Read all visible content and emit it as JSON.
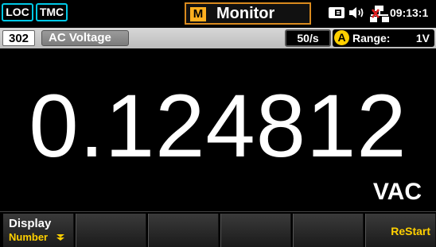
{
  "status_bar": {
    "loc_badge": "LOC",
    "tmc_badge": "TMC",
    "mode_letter": "M",
    "mode_title": "Monitor",
    "time": "09:13:1",
    "icons": [
      "storage-icon",
      "speaker-icon",
      "network-disconnected-icon"
    ]
  },
  "info_bar": {
    "channel": "302",
    "function": "AC Voltage",
    "rate": "50/s",
    "auto_indicator": "A",
    "range_label": "Range:",
    "range_value": "1V"
  },
  "reading": {
    "value": "0.124812",
    "unit": "VAC"
  },
  "softkeys": {
    "display_title": "Display",
    "display_value": "Number",
    "restart_label": "ReStart"
  },
  "colors": {
    "accent_cyan": "#00c8e6",
    "mode_orange": "#d98a1e",
    "softkey_yellow": "#ffd000",
    "network_error_red": "#e02020"
  }
}
